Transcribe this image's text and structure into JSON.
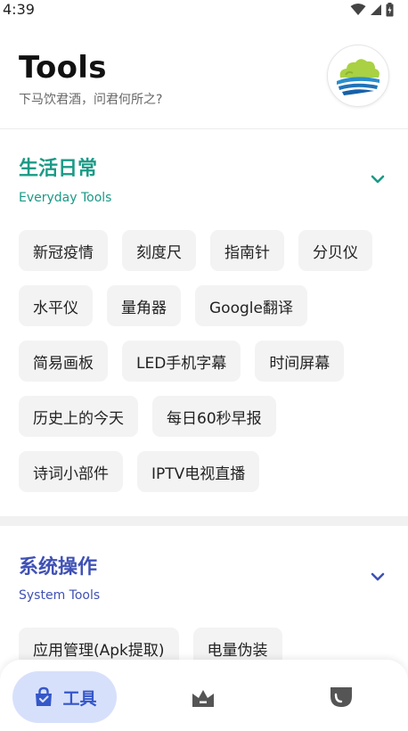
{
  "status_bar": {
    "time": "4:39"
  },
  "header": {
    "title": "Tools",
    "subtitle": "下马饮君酒，问君何所之?"
  },
  "colors": {
    "everyday_accent": "#1a9a86",
    "system_accent": "#3f51b5",
    "nav_active_bg": "#d7e0fb",
    "nav_active_fg": "#3557c9"
  },
  "sections": {
    "everyday": {
      "title": "生活日常",
      "subtitle": "Everyday Tools",
      "items": [
        "新冠疫情",
        "刻度尺",
        "指南针",
        "分贝仪",
        "水平仪",
        "量角器",
        "Google翻译",
        "简易画板",
        "LED手机字幕",
        "时间屏幕",
        "历史上的今天",
        "每日60秒早报",
        "诗词小部件",
        "IPTV电视直播"
      ]
    },
    "system": {
      "title": "系统操作",
      "subtitle": "System Tools",
      "items": [
        "应用管理(Apk提取)",
        "电量伪装"
      ]
    }
  },
  "bottom_nav": {
    "active_label": "工具",
    "icons": [
      "shopping-bag-icon",
      "crown-icon",
      "shield-icon"
    ]
  }
}
